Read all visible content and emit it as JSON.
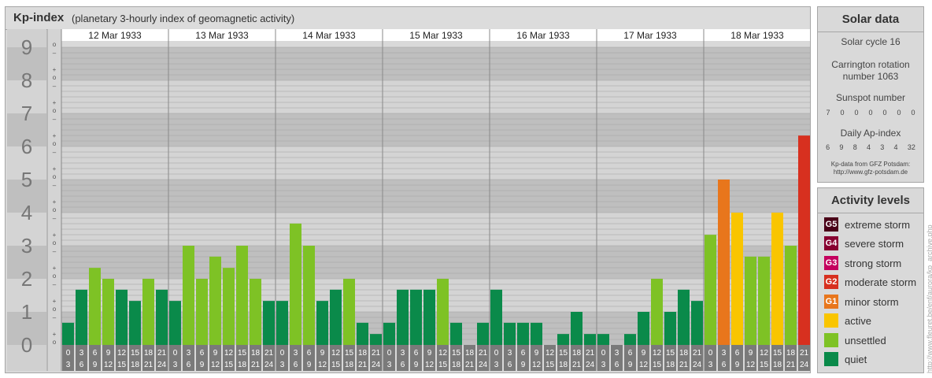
{
  "header": {
    "title": "Kp-index",
    "subtitle": "(planetary 3-hourly index of geomagnetic activity)"
  },
  "chart_data": {
    "type": "bar",
    "title": "Kp-index",
    "subtitle": "(planetary 3-hourly index of geomagnetic activity)",
    "days": [
      "12 Mar 1933",
      "13 Mar 1933",
      "14 Mar 1933",
      "15 Mar 1933",
      "16 Mar 1933",
      "17 Mar 1933",
      "18 Mar 1933"
    ],
    "intervals_start": [
      "0",
      "3",
      "6",
      "9",
      "12",
      "15",
      "18",
      "21"
    ],
    "intervals_end": [
      "3",
      "6",
      "9",
      "12",
      "15",
      "18",
      "21",
      "24"
    ],
    "y_ticks": [
      "0",
      "1",
      "2",
      "3",
      "4",
      "5",
      "6",
      "7",
      "8",
      "9"
    ],
    "minor_ticks": [
      "o",
      "+",
      "–"
    ],
    "ylim": [
      0,
      9
    ],
    "grid": true,
    "values": [
      [
        0.67,
        1.67,
        2.33,
        2.0,
        1.67,
        1.33,
        2.0,
        1.67
      ],
      [
        1.33,
        3.0,
        2.0,
        2.67,
        2.33,
        3.0,
        2.0,
        1.33
      ],
      [
        1.33,
        3.67,
        3.0,
        1.33,
        1.67,
        2.0,
        0.67,
        0.33
      ],
      [
        0.67,
        1.67,
        1.67,
        1.67,
        2.0,
        0.67,
        0.0,
        0.67
      ],
      [
        1.67,
        0.67,
        0.67,
        0.67,
        0.0,
        0.33,
        1.0,
        0.33
      ],
      [
        0.33,
        0.0,
        0.33,
        1.0,
        2.0,
        1.0,
        1.67,
        1.33
      ],
      [
        3.33,
        5.0,
        4.0,
        2.67,
        2.67,
        4.0,
        3.0,
        6.33
      ]
    ]
  },
  "solar": {
    "title": "Solar data",
    "cycle": "Solar cycle 16",
    "carrington_line1": "Carrington rotation",
    "carrington_line2": "number 1063",
    "sunspot_label": "Sunspot number",
    "sunspot_values": [
      "7",
      "0",
      "0",
      "0",
      "0",
      "0",
      "0"
    ],
    "ap_label": "Daily Ap-index",
    "ap_values": [
      "6",
      "9",
      "8",
      "4",
      "3",
      "4",
      "32"
    ],
    "source_line1": "Kp-data from GFZ Potsdam:",
    "source_line2": "http://www.gfz-potsdam.de"
  },
  "activity": {
    "title": "Activity levels",
    "items": [
      {
        "badge": "G5",
        "label": "extreme storm",
        "color": "#4a0018"
      },
      {
        "badge": "G4",
        "label": "severe storm",
        "color": "#880030"
      },
      {
        "badge": "G3",
        "label": "strong storm",
        "color": "#c4005e"
      },
      {
        "badge": "G2",
        "label": "moderate storm",
        "color": "#d7301f"
      },
      {
        "badge": "G1",
        "label": "minor storm",
        "color": "#e8761c"
      },
      {
        "badge": "",
        "label": "active",
        "color": "#f9c500"
      },
      {
        "badge": "",
        "label": "unsettled",
        "color": "#7ec225"
      },
      {
        "badge": "",
        "label": "quiet",
        "color": "#0a8a4a"
      }
    ]
  },
  "credit": "http://www.fleuret.be/enf/aurora/kp_archive.php"
}
